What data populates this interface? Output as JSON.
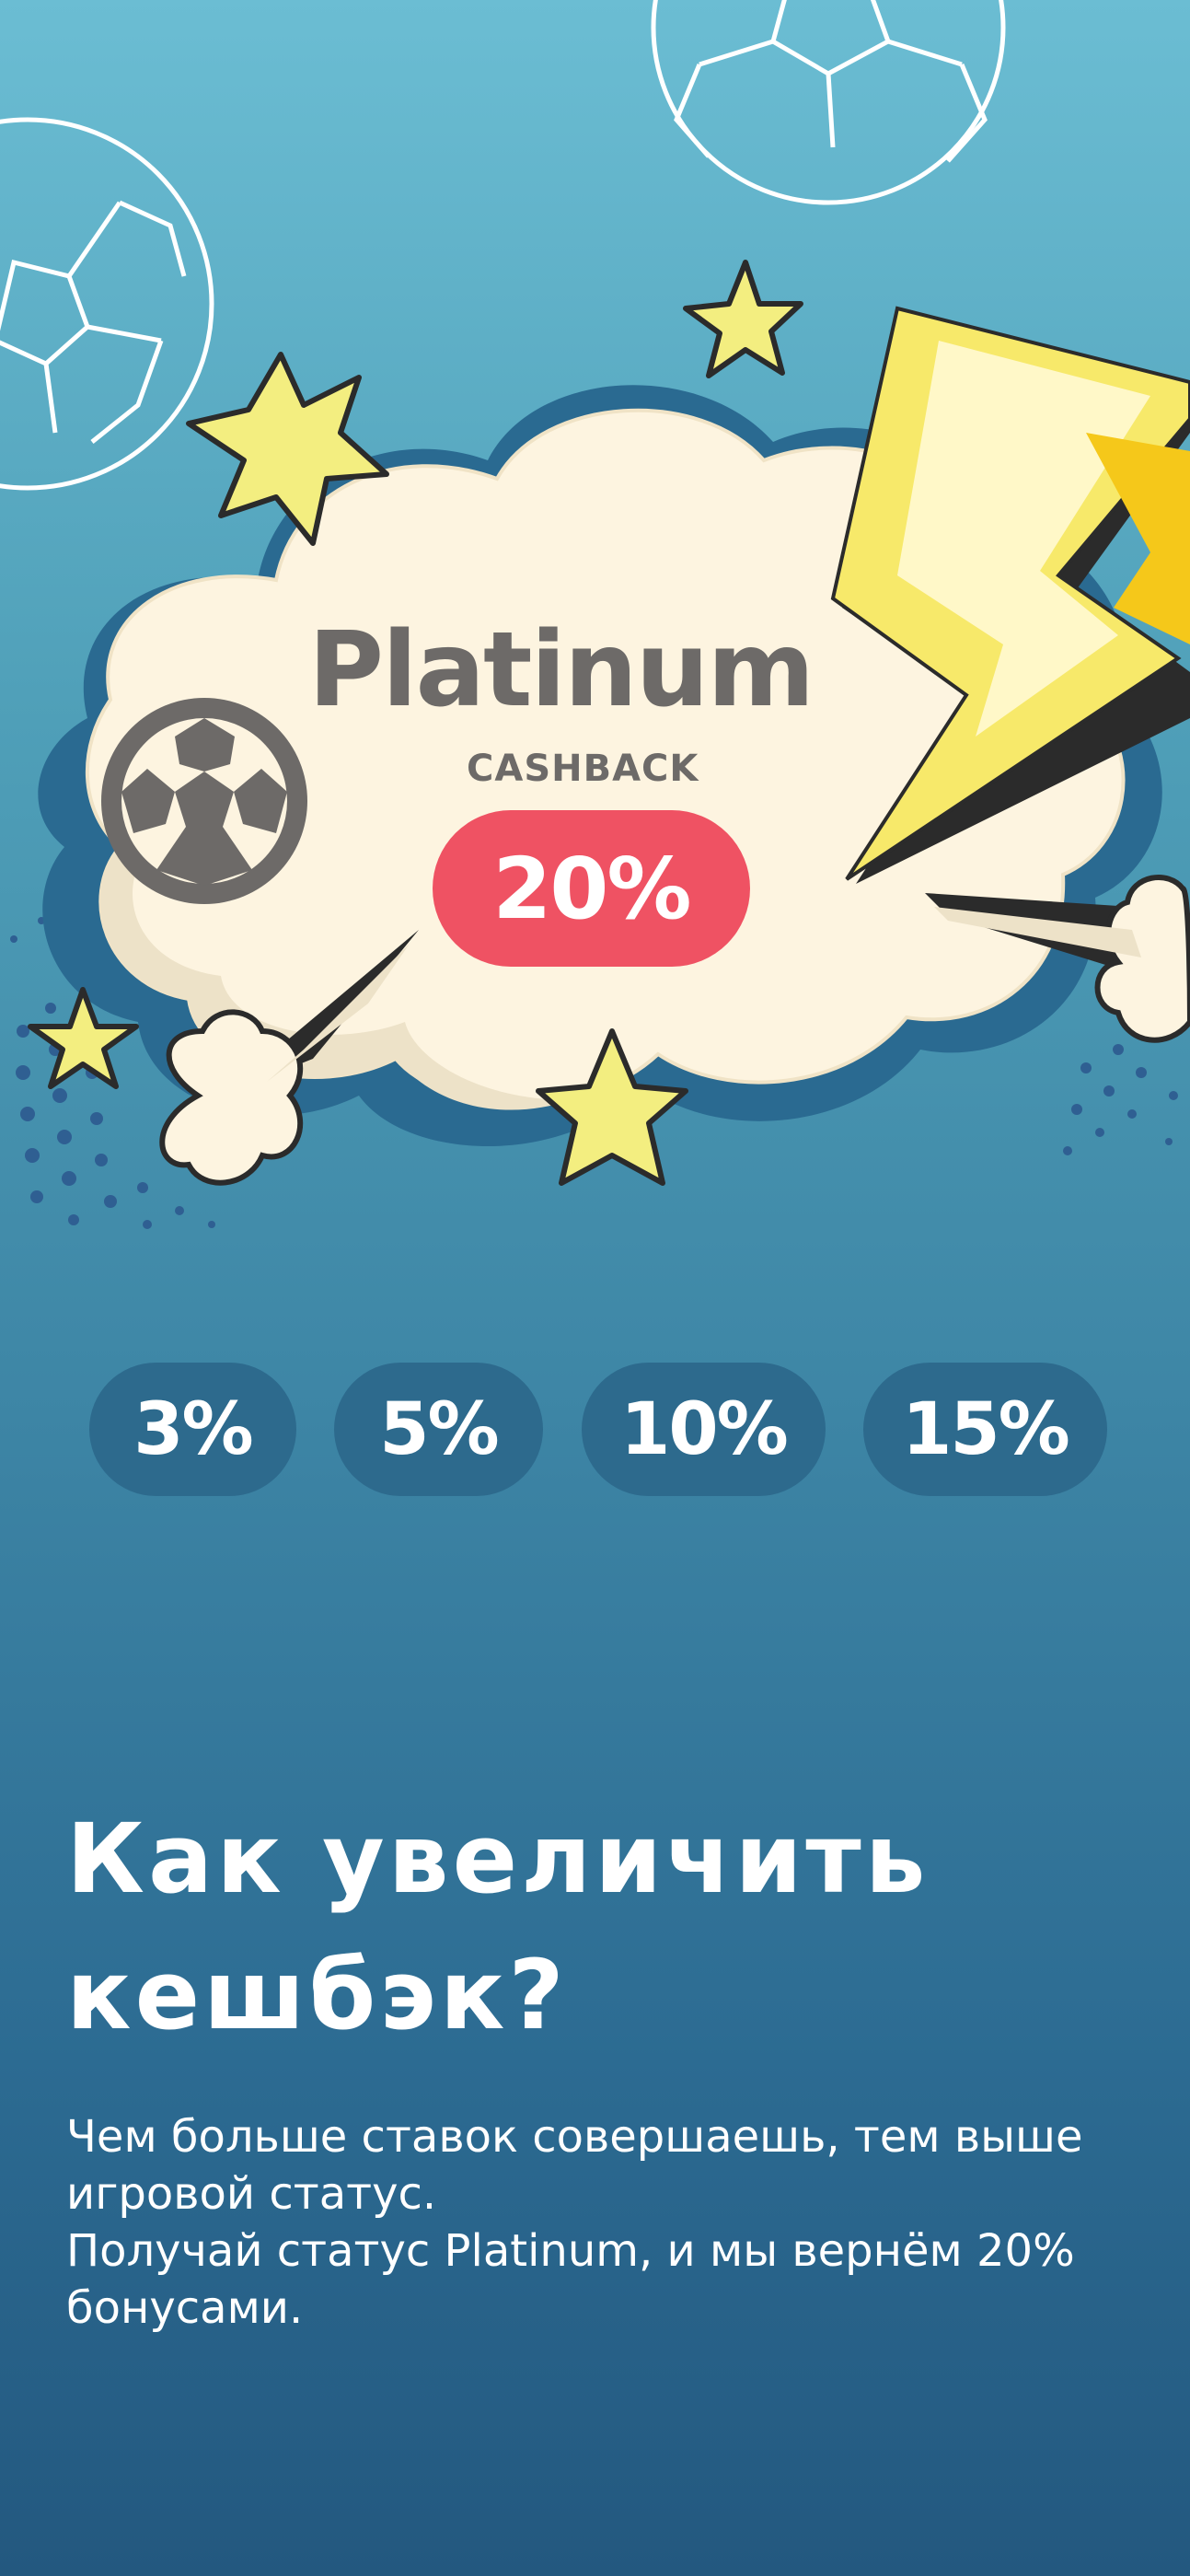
{
  "promo": {
    "status_name": "Platinum",
    "cashback_label": "CASHBACK",
    "cashback_percent": "20%"
  },
  "levels": [
    "3%",
    "5%",
    "10%",
    "15%"
  ],
  "info": {
    "heading_line1": "Как увеличить",
    "heading_line2": "кешбэк?",
    "description_line1": "Чем больше ставок совершаешь, тем выше игровой статус.",
    "description_line2": "Получай статус Platinum, и мы вернём 20% бонусами."
  },
  "colors": {
    "background_top": "#6bbdd3",
    "background_bottom": "#23587f",
    "level_pill": "#2d6a8d",
    "percent_pill": "#ef5263",
    "cloud": "#fdf4e0",
    "star": "#f3ee80",
    "lightning": "#f7e96a"
  },
  "icons": [
    "soccer-ball-icon",
    "star-icon",
    "lightning-bolt-icon"
  ]
}
